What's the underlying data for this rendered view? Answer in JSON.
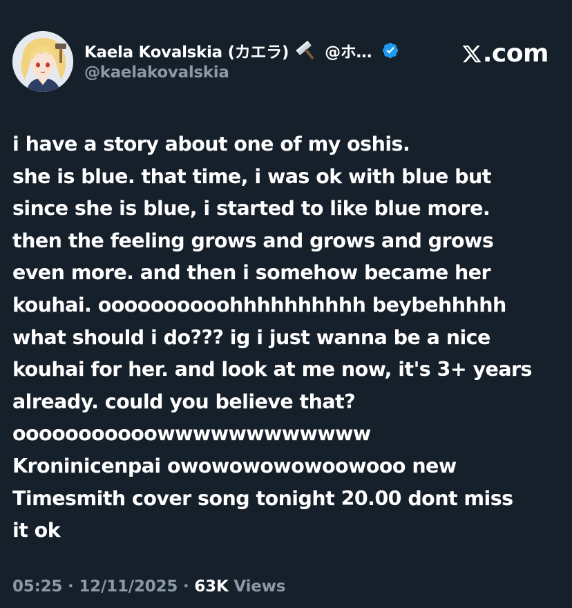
{
  "author": {
    "display_name": "Kaela Kovalskia (カエラ)",
    "handle_truncated": "@ホ…",
    "handle": "@kaelakovalskia",
    "verified": true,
    "emoji_icon": "hammer-icon"
  },
  "brand": {
    "text": ".com",
    "logo": "x-logo-icon"
  },
  "tweet": {
    "lines": [
      "i have a story about one of my oshis.",
      "she is blue. that time, i was ok with blue but",
      "since she is blue, i started to like blue more.",
      "then the feeling grows and grows and grows",
      "even more. and then i somehow became her",
      "kouhai. oooooooooohhhhhhhhhh beybehhhhh",
      "what should i do??? ig i just wanna be a nice",
      "kouhai for her. and look at me now, it's 3+ years",
      "already. could you believe that?",
      "ooooooooooowwwwwwwwwwww",
      "Kroninicenpai owowowowowoowooo new",
      "Timesmith cover song tonight 20.00 dont miss",
      "it ok"
    ]
  },
  "meta": {
    "time": "05:25",
    "separator": " · ",
    "date": "12/11/2025",
    "views_count": "63K",
    "views_label": " Views"
  },
  "colors": {
    "background": "#15202b",
    "text": "#ffffff",
    "secondary": "#8b98a5",
    "verified": "#1d9bf0"
  }
}
